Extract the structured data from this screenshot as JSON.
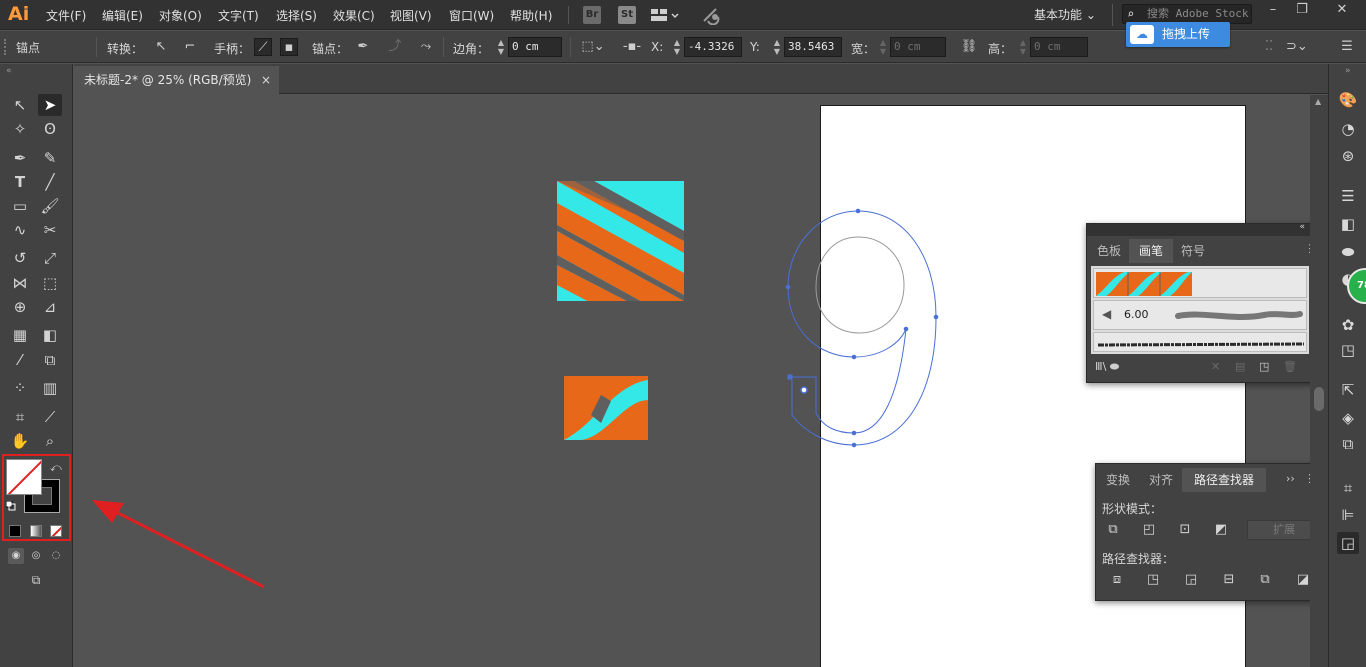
{
  "app": {
    "logo": "Ai"
  },
  "menu": [
    "文件(F)",
    "编辑(E)",
    "对象(O)",
    "文字(T)",
    "选择(S)",
    "效果(C)",
    "视图(V)",
    "窗口(W)",
    "帮助(H)"
  ],
  "menubar": {
    "bridge_badge": "Br",
    "stock_badge": "St",
    "workspace_label": "基本功能",
    "search_placeholder": "搜索 Adobe Stock",
    "upload_button": "拖拽上传"
  },
  "controlbar": {
    "anchor_label": "锚点",
    "convert_label": "转换：",
    "handles_label": "手柄：",
    "anchors_label": "锚点：",
    "corner_label": "边角：",
    "corner_value": "0 cm",
    "x_label": "X:",
    "x_value": "-4.3326 c",
    "y_label": "Y:",
    "y_value": "38.5463 c",
    "w_label": "宽：",
    "w_value": "0 cm",
    "h_label": "高：",
    "h_value": "0 cm"
  },
  "document_tab": {
    "title": "未标题-2* @ 25% (RGB/预览)",
    "close": "×"
  },
  "brushes_panel": {
    "tabs": [
      "色板",
      "画笔",
      "符号"
    ],
    "active_tab": "画笔",
    "brush_size": "6.00"
  },
  "pathfinder_panel": {
    "tabs": [
      "变换",
      "对齐",
      "路径查找器"
    ],
    "active_tab": "路径查找器",
    "shape_modes_label": "形状模式：",
    "pathfinders_label": "路径查找器：",
    "expand_label": "扩展"
  },
  "colors": {
    "orange": "#e8681a",
    "cyan": "#34e8e8",
    "stripe_gray": "#5f5f5f",
    "path_blue": "#4a6fd6",
    "highlight_red": "#e02020",
    "upload_blue": "#3d8be0"
  },
  "annotation": {
    "arrow": "red-arrow-pointing-to-color-controls"
  },
  "green_badge": "78"
}
